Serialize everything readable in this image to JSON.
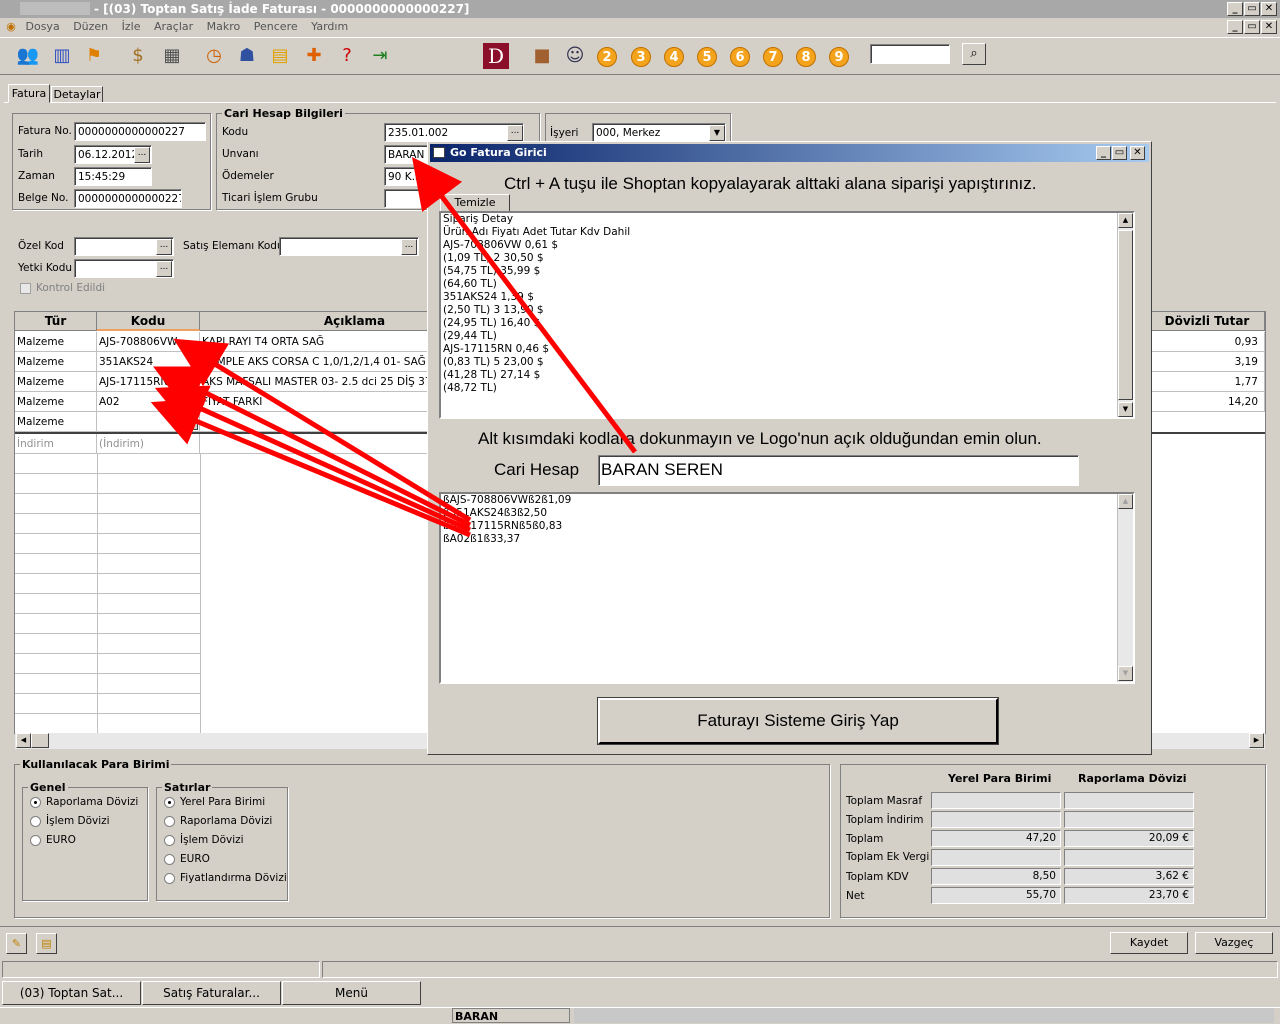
{
  "window": {
    "title": "- [(03) Toptan Satış İade Faturası - 0000000000000227]",
    "min": "_",
    "max": "▭",
    "close": "✕"
  },
  "menu": [
    "Dosya",
    "Düzen",
    "İzle",
    "Araçlar",
    "Makro",
    "Pencere",
    "Yardım"
  ],
  "toolbar": {
    "letter": "D",
    "numbers": [
      "2",
      "3",
      "4",
      "5",
      "6",
      "7",
      "8",
      "9"
    ],
    "search_value": ""
  },
  "tabs": [
    "Fatura",
    "Detaylar"
  ],
  "invoice": {
    "fatura_no_label": "Fatura No.",
    "fatura_no": "0000000000000227",
    "tarih_label": "Tarih",
    "tarih": "06.12.2012",
    "zaman_label": "Zaman",
    "zaman": "15:45:29",
    "belge_no_label": "Belge No.",
    "belge_no": "0000000000000227"
  },
  "cari": {
    "title": "Cari Hesap Bilgileri",
    "kodu_label": "Kodu",
    "kodu": "235.01.002",
    "unvani_label": "Unvanı",
    "unvani": "BARAN",
    "odemeler_label": "Ödemeler",
    "odemeler": "90 K.K.",
    "ticari_label": "Ticari İşlem Grubu",
    "ticari": ""
  },
  "isyeri": {
    "label": "İşyeri",
    "value": "000, Merkez"
  },
  "extra": {
    "ozel_kod_label": "Özel Kod",
    "yetki_kodu_label": "Yetki Kodu",
    "satis_elemani_label": "Satış Elemanı Kodu",
    "kontrol_label": "Kontrol Edildi"
  },
  "grid": {
    "headers": [
      "Tür",
      "Kodu",
      "Açıklama",
      "Dövizli Tutar"
    ],
    "rows": [
      {
        "tur": "Malzeme",
        "kodu": "AJS-708806VW",
        "aciklama": "KAPI RAYI T4 ORTA SAĞ",
        "doviz": "0,93"
      },
      {
        "tur": "Malzeme",
        "kodu": "351AKS24",
        "aciklama": "KOMPLE AKS CORSA C 1,0/1,2/1,4 01- SAĞ",
        "doviz": "3,19"
      },
      {
        "tur": "Malzeme",
        "kodu": "AJS-17115RN",
        "aciklama": "AKS MAFSALI MASTER 03- 2.5 dci 25 DİŞ 37mm",
        "doviz": "1,77"
      },
      {
        "tur": "Malzeme",
        "kodu": "A02",
        "aciklama": "FİYAT FARKI",
        "doviz": "14,20"
      },
      {
        "tur": "Malzeme",
        "kodu": "",
        "aciklama": "",
        "doviz": ""
      }
    ],
    "indirim": "İndirim",
    "indirim_code": "(İndirim)"
  },
  "dialog": {
    "title": "Go Fatura Girici",
    "instruction": "Ctrl + A tuşu ile Shoptan kopyalayarak alttaki alana siparişi yapıştırınız.",
    "clear_button": "Temizle",
    "order_lines": [
      "Sipariş Detay",
      "Ürün Adı Fiyatı Adet Tutar Kdv Dahil",
      "AJS-708806VW   0,61 $",
      "(1,09 TL) 2 30,50 $",
      "(54,75 TL) 35,99 $",
      "(64,60 TL)",
      "351AKS24   1,39 $",
      "(2,50 TL) 3 13,90 $",
      "(24,95 TL) 16,40 $",
      "(29,44 TL)",
      "AJS-17115RN   0,46 $",
      "(0,83 TL) 5 23,00 $",
      "(41,28 TL) 27,14 $",
      "(48,72 TL)"
    ],
    "warning": "Alt kısımdaki kodlara dokunmayın ve Logo'nun açık olduğundan emin olun.",
    "cari_label": "Cari Hesap",
    "cari_value": "BARAN SEREN",
    "code_lines": [
      "ßAJS-708806VWß2ß1,09",
      "ß351AKS24ß3ß2,50",
      "ßAJS-17115RNß5ß0,83",
      "ßA02ß1ß33,37"
    ],
    "submit": "Faturayı Sisteme Giriş Yap"
  },
  "currency": {
    "title": "Kullanılacak Para Birimi",
    "genel_title": "Genel",
    "genel": [
      "Raporlama Dövizi",
      "İşlem Dövizi",
      "EURO"
    ],
    "satirlar_title": "Satırlar",
    "satirlar": [
      "Yerel Para Birimi",
      "Raporlama Dövizi",
      "İşlem Dövizi",
      "EURO",
      "Fiyatlandırma Dövizi"
    ]
  },
  "totals": {
    "col1": "Yerel Para Birimi",
    "col2": "Raporlama Dövizi",
    "rows": [
      {
        "label": "Toplam Masraf",
        "v1": "",
        "v2": ""
      },
      {
        "label": "Toplam İndirim",
        "v1": "",
        "v2": ""
      },
      {
        "label": "Toplam",
        "v1": "47,20",
        "v2": "20,09 €"
      },
      {
        "label": "Toplam Ek Vergi",
        "v1": "",
        "v2": ""
      },
      {
        "label": "Toplam KDV",
        "v1": "8,50",
        "v2": "3,62 €"
      },
      {
        "label": "Net",
        "v1": "55,70",
        "v2": "23,70 €"
      }
    ]
  },
  "actions": {
    "kaydet": "Kaydet",
    "vazgec": "Vazgeç"
  },
  "taskbar": [
    "(03) Toptan Sat...",
    "Satış Faturalar...",
    "Menü"
  ],
  "statusbar": {
    "user": "BARAN"
  },
  "colors": {
    "arrow": "#ff0000",
    "dialog_title": "#0a246a",
    "number_badge": "#f3a31c"
  }
}
